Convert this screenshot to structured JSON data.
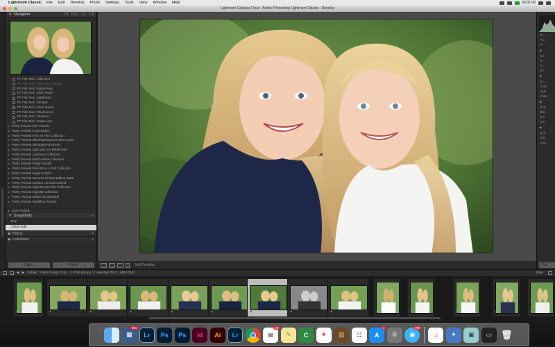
{
  "menubar": {
    "app_name": "Lightroom Classic",
    "items": [
      "File",
      "Edit",
      "Develop",
      "Photo",
      "Settings",
      "Tools",
      "View",
      "Window",
      "Help"
    ],
    "clock": "00:01:08"
  },
  "window": {
    "title": "Lightroom Catalog-2.lrcat - Adobe Photoshop Lightroom Classic - Develop"
  },
  "left_panel": {
    "navigator_label": "Navigator",
    "navigator_options": [
      "FIT",
      "FILL",
      "1:1",
      "1:4"
    ],
    "presets": [
      {
        "label": "PF Film Noir: Collection",
        "type": "item",
        "dim": false
      },
      {
        "label": "PF Film Noir: Gritty Noir Vintage",
        "type": "item",
        "dim": true
      },
      {
        "label": "PF Film Noir: Purple Rain",
        "type": "item",
        "dim": false
      },
      {
        "label": "PF Film Noir: Silver Pearl",
        "type": "item",
        "dim": false
      },
      {
        "label": "PF Film Noir: Lightboard",
        "type": "item",
        "dim": false
      },
      {
        "label": "PF Film Noir: Glimpse",
        "type": "item",
        "dim": false
      },
      {
        "label": "PF Film Noir: Good Moves",
        "type": "item",
        "dim": false
      },
      {
        "label": "PF Film Noir: Chiaroscuro",
        "type": "item",
        "dim": false
      },
      {
        "label": "PF Film Noir: Timeless",
        "type": "item",
        "dim": false
      },
      {
        "label": "PF Film Noir: Velvet Lace",
        "type": "item",
        "dim": false
      },
      {
        "label": "Pretty Presets Film Presets",
        "type": "folder",
        "dim": false
      },
      {
        "label": "Pretty Presets Food Toolkit",
        "type": "folder",
        "dim": false
      },
      {
        "label": "Pretty Presets Fine Art Film Collection",
        "type": "folder",
        "dim": false
      },
      {
        "label": "Pretty Presets Illuminate BONUS Skin Looks",
        "type": "folder",
        "dim": false
      },
      {
        "label": "Pretty Presets Illuminate Advanced",
        "type": "folder",
        "dim": false
      },
      {
        "label": "Pretty Presets Light and Airy Wilderness",
        "type": "folder",
        "dim": false
      },
      {
        "label": "Pretty Presets Luminous Collection",
        "type": "folder",
        "dim": false
      },
      {
        "label": "Pretty Presets Match Matte Collection",
        "type": "folder",
        "dim": false
      },
      {
        "label": "Pretty Presets Pretty Presets",
        "type": "folder",
        "dim": false
      },
      {
        "label": "Pretty Presets Rock Rock n Roll Collection",
        "type": "folder",
        "dim": false
      },
      {
        "label": "Pretty Presets Sugar & Spice",
        "type": "folder",
        "dim": false
      },
      {
        "label": "Pretty Presets Summer Limited Edition 2019",
        "type": "folder",
        "dim": false
      },
      {
        "label": "Pretty Presets Surface Luminous Blend",
        "type": "folder",
        "dim": false
      },
      {
        "label": "Pretty Presets Vignette and Blur Collection",
        "type": "folder",
        "dim": false
      },
      {
        "label": "Pretty Presets Vignette Collection",
        "type": "folder",
        "dim": false
      },
      {
        "label": "Pretty Presets Winter Wonderland",
        "type": "folder",
        "dim": false
      },
      {
        "label": "Pretty Presets Workflow Presets",
        "type": "folder",
        "dim": false
      },
      {
        "label": "",
        "type": "spacer",
        "dim": false
      },
      {
        "label": "User Presets",
        "type": "folder",
        "dim": false
      },
      {
        "label": "Contrasty BW",
        "type": "sub",
        "dim": false
      }
    ],
    "snapshots_label": "Snapshots",
    "snapshots": [
      {
        "label": "BW",
        "active": false
      },
      {
        "label": "Clean Edit",
        "active": true
      }
    ],
    "history_label": "History",
    "collections_label": "Collections",
    "copy_button": "Copy...",
    "paste_button": "Paste"
  },
  "toolbar": {
    "sort_label": "Soft Proofing"
  },
  "right_panel": {
    "labels": [
      "Ty",
      "Pro",
      "Pi",
      "Edi",
      "W",
      "Te",
      "Sh",
      "Ex",
      "Contr",
      "High",
      "Shad",
      "Whit",
      "Blac",
      "Tex",
      "Cla",
      "Deh",
      "Vibr",
      "Satu"
    ],
    "button": "Pre"
  },
  "filmstrip_bar": {
    "folder": "Folder : Smith Family 2019",
    "count": "1 of 86 photos / 1 selected /DSC_9480.DNG",
    "filter_label": "Filter :"
  },
  "dock": {
    "badge_lr": "961",
    "badge_calendar": "30",
    "badge_messages": "308"
  }
}
